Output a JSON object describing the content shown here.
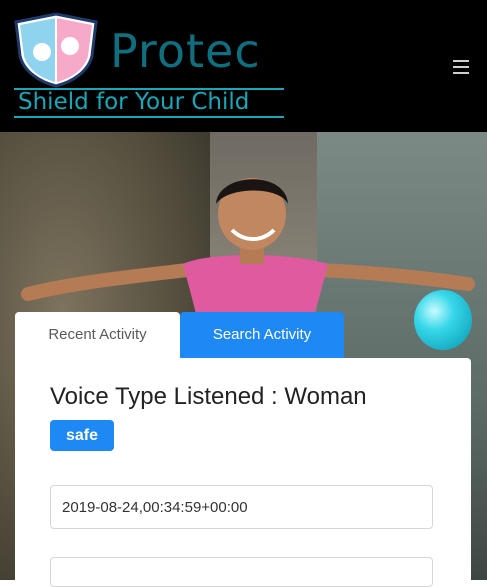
{
  "brand": {
    "name": "Protec",
    "tagline": "Shield for Your Child",
    "color_primary": "#0f6f7f",
    "color_accent": "#1aa7b7"
  },
  "nav": {
    "menu_icon": "hamburger-icon"
  },
  "tabs": [
    {
      "label": "Recent Activity",
      "active": true
    },
    {
      "label": "Search Activity",
      "active": false
    }
  ],
  "activity": {
    "title": "Voice Type Listened : Woman",
    "status_badge": "safe",
    "status_color": "#1e88f5",
    "timestamp": "2019-08-24,00:34:59+00:00",
    "next_field_value": ""
  }
}
